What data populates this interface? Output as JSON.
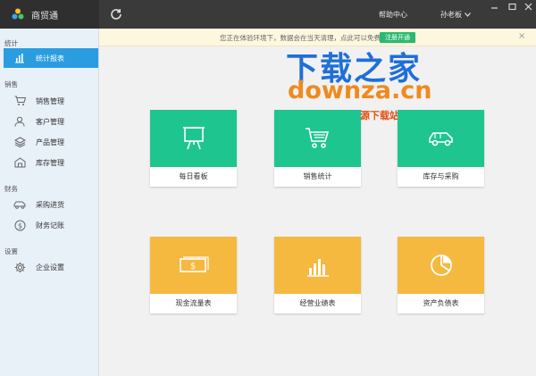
{
  "app": {
    "title": "商贸通"
  },
  "header": {
    "help": "帮助中心",
    "user": "孙老板"
  },
  "notice": {
    "text": "您正在体验环境下，数据会在当天清理，点此可以免费",
    "button": "注册开通",
    "close": "×"
  },
  "sidebar": {
    "sections": [
      {
        "title": "统计",
        "items": [
          {
            "label": "统计报表",
            "icon": "bar-chart-icon",
            "active": true
          }
        ]
      },
      {
        "title": "销售",
        "items": [
          {
            "label": "销售管理",
            "icon": "cart-icon"
          },
          {
            "label": "客户管理",
            "icon": "user-icon"
          },
          {
            "label": "产品管理",
            "icon": "layers-icon"
          },
          {
            "label": "库存管理",
            "icon": "warehouse-icon"
          }
        ]
      },
      {
        "title": "财务",
        "items": [
          {
            "label": "采购进货",
            "icon": "car-icon"
          },
          {
            "label": "财务记账",
            "icon": "dollar-icon"
          }
        ]
      },
      {
        "title": "设置",
        "items": [
          {
            "label": "企业设置",
            "icon": "gear-icon"
          }
        ]
      }
    ]
  },
  "watermark": {
    "line1": "下载之家",
    "line2": "downza.cn",
    "line3": "国内最专业的资源下载站！"
  },
  "cards": [
    {
      "label": "每日看板",
      "icon": "presentation-board-icon",
      "color": "#1fc58f"
    },
    {
      "label": "销售统计",
      "icon": "cart-icon",
      "color": "#1fc58f"
    },
    {
      "label": "库存与采购",
      "icon": "car-icon",
      "color": "#1fc58f"
    },
    {
      "label": "现金流量表",
      "icon": "banknote-icon",
      "color": "#f5b93f"
    },
    {
      "label": "经营业绩表",
      "icon": "bar-chart-icon",
      "color": "#f5b93f"
    },
    {
      "label": "资产负债表",
      "icon": "pie-chart-icon",
      "color": "#f5b93f"
    }
  ]
}
